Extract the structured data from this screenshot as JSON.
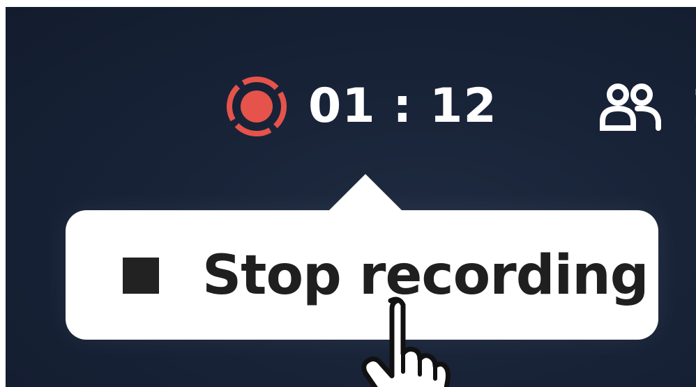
{
  "recording": {
    "status_icon": "recording-dot-icon",
    "elapsed": "01 : 12",
    "indicator_color": "#e5534b"
  },
  "toolbar": {
    "participants_icon": "participants-icon",
    "clipped_next": "1"
  },
  "tooltip": {
    "stop_icon": "stop-square-icon",
    "stop_label": "Stop recording"
  },
  "cursor": {
    "icon": "hand-pointer-icon"
  },
  "theme": {
    "background": "#172236",
    "tooltip_bg": "#ffffff",
    "text_light": "#ffffff",
    "text_dark": "#1f1f1f"
  }
}
